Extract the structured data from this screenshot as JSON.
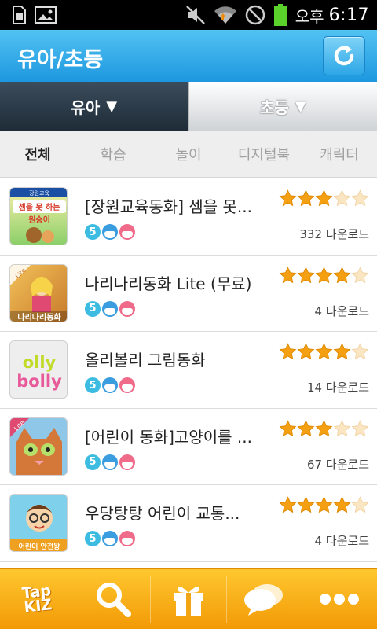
{
  "status_bar": {
    "left_icons": [
      "sim-card-icon",
      "gallery-icon"
    ],
    "right_icons": [
      "mute-icon",
      "wifi-icon",
      "no-signal-icon",
      "battery-icon"
    ],
    "ampm": "오후",
    "time": "6:17",
    "battery_color": "#5bd12b"
  },
  "header": {
    "title": "유아/초등",
    "refresh_icon": "refresh-icon",
    "accent": "#1d97df"
  },
  "segment_tabs": [
    {
      "label": "유아",
      "arrow": "▼",
      "active": true
    },
    {
      "label": "초등",
      "arrow": "▼",
      "active": false
    }
  ],
  "category_tabs": [
    {
      "label": "전체",
      "selected": true
    },
    {
      "label": "학습",
      "selected": false
    },
    {
      "label": "놀이",
      "selected": false
    },
    {
      "label": "디지털북",
      "selected": false
    },
    {
      "label": "캐릭터",
      "selected": false
    }
  ],
  "apps": [
    {
      "title": "[장원교육동화] 셈을 못...",
      "age": "5",
      "rating": 3,
      "downloads": "332 다운로드",
      "thumb_text": [
        "장원교육",
        "셈을 못 하는",
        "원숭이"
      ]
    },
    {
      "title": "나리나리동화 Lite (무료)",
      "age": "5",
      "rating": 4,
      "downloads": "4 다운로드",
      "thumb_text": [
        "Lite",
        "나리나리동화"
      ]
    },
    {
      "title": "올리볼리 그림동화",
      "age": "5",
      "rating": 4,
      "downloads": "14 다운로드",
      "thumb_text": [
        "olly",
        "bolly"
      ]
    },
    {
      "title": "[어린이 동화]고양이를 ...",
      "age": "5",
      "rating": 3,
      "downloads": "67 다운로드",
      "thumb_text": [
        "Lite"
      ]
    },
    {
      "title": "우당탕탕 어린이 교통...",
      "age": "5",
      "rating": 4,
      "downloads": "4 다운로드",
      "thumb_text": [
        "어린이 안전왕"
      ]
    }
  ],
  "bottom_bar": {
    "logo": [
      "Tap",
      "KIZ"
    ],
    "items": [
      "search-icon",
      "gift-icon",
      "chat-icon",
      "more-icon"
    ]
  }
}
